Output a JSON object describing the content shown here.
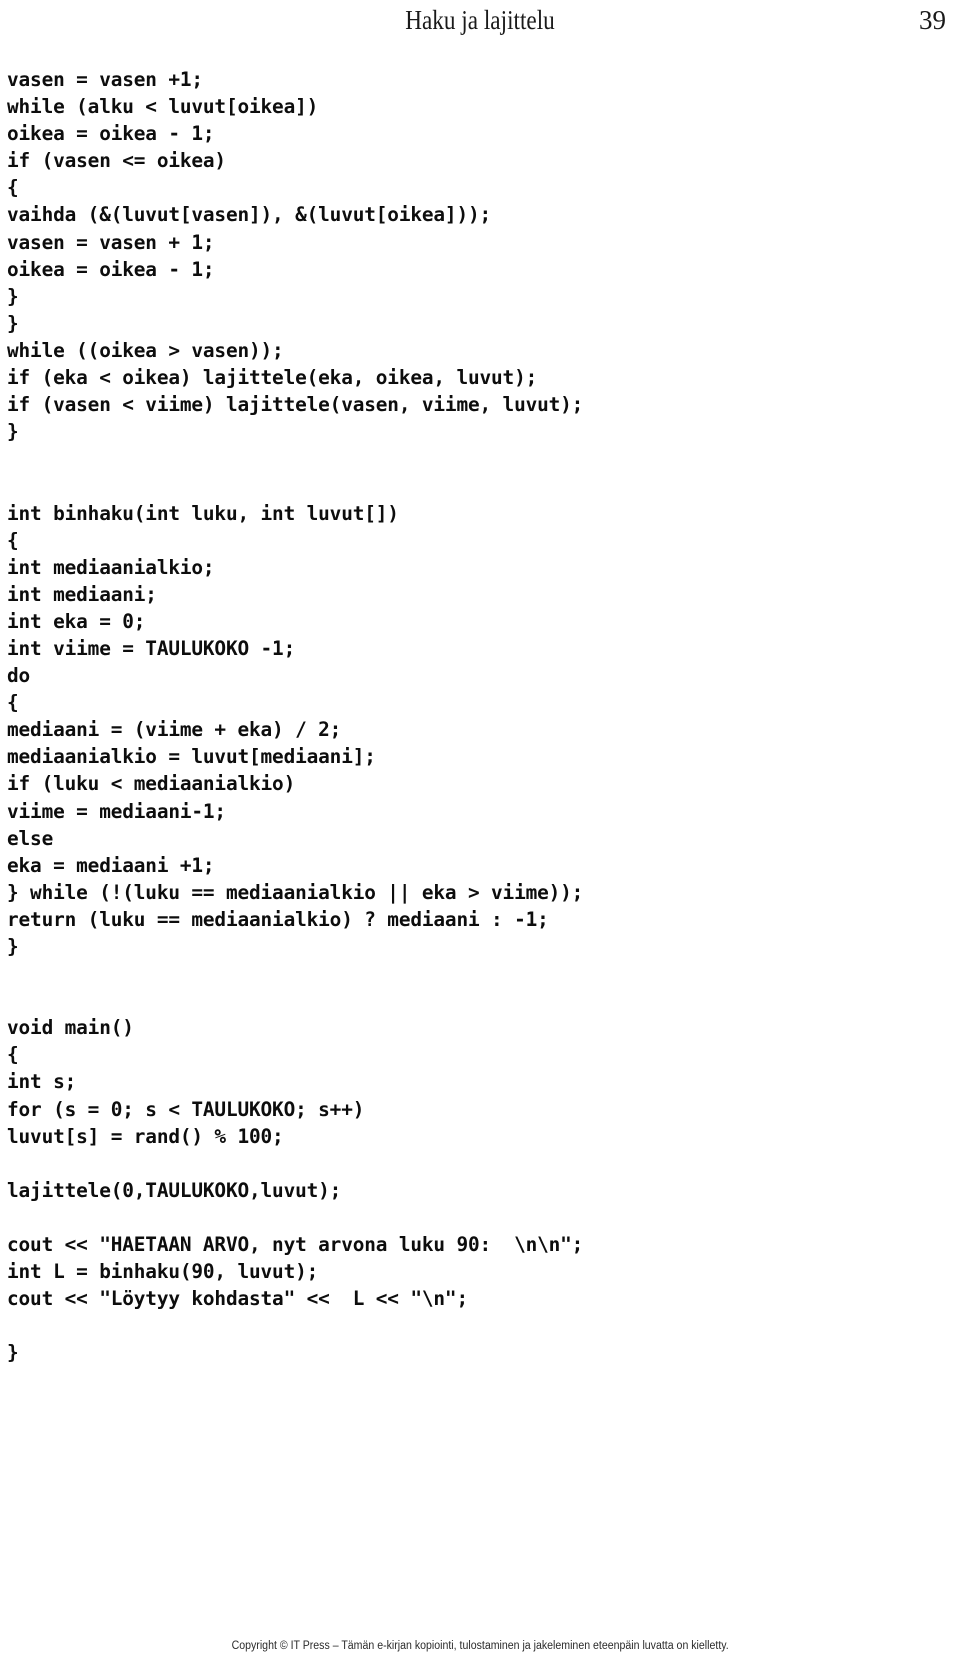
{
  "header": {
    "title": "Haku ja lajittelu",
    "page_number": "39"
  },
  "code": {
    "lines": [
      "vasen = vasen +1;",
      "while (alku < luvut[oikea])",
      "oikea = oikea - 1;",
      "if (vasen <= oikea)",
      "{",
      "vaihda (&(luvut[vasen]), &(luvut[oikea]));",
      "vasen = vasen + 1;",
      "oikea = oikea - 1;",
      "}",
      "}",
      "while ((oikea > vasen));",
      "if (eka < oikea) lajittele(eka, oikea, luvut);",
      "if (vasen < viime) lajittele(vasen, viime, luvut);",
      "}",
      "",
      "",
      "int binhaku(int luku, int luvut[])",
      "{",
      "int mediaanialkio;",
      "int mediaani;",
      "int eka = 0;",
      "int viime = TAULUKOKO -1;",
      "do",
      "{",
      "mediaani = (viime + eka) / 2;",
      "mediaanialkio = luvut[mediaani];",
      "if (luku < mediaanialkio)",
      "viime = mediaani-1;",
      "else",
      "eka = mediaani +1;",
      "} while (!(luku == mediaanialkio || eka > viime));",
      "return (luku == mediaanialkio) ? mediaani : -1;",
      "}",
      "",
      "",
      "void main()",
      "{",
      "int s;",
      "for (s = 0; s < TAULUKOKO; s++)",
      "luvut[s] = rand() % 100;",
      "",
      "lajittele(0,TAULUKOKO,luvut);",
      "",
      "cout << \"HAETAAN ARVO, nyt arvona luku 90:  \\n\\n\";",
      "int L = binhaku(90, luvut);",
      "cout << \"Löytyy kohdasta\" <<  L << \"\\n\";",
      "",
      "}"
    ]
  },
  "footer": {
    "copyright": "Copyright © IT Press – Tämän e-kirjan kopiointi, tulostaminen ja jakeleminen eteenpäin luvatta on kielletty."
  }
}
